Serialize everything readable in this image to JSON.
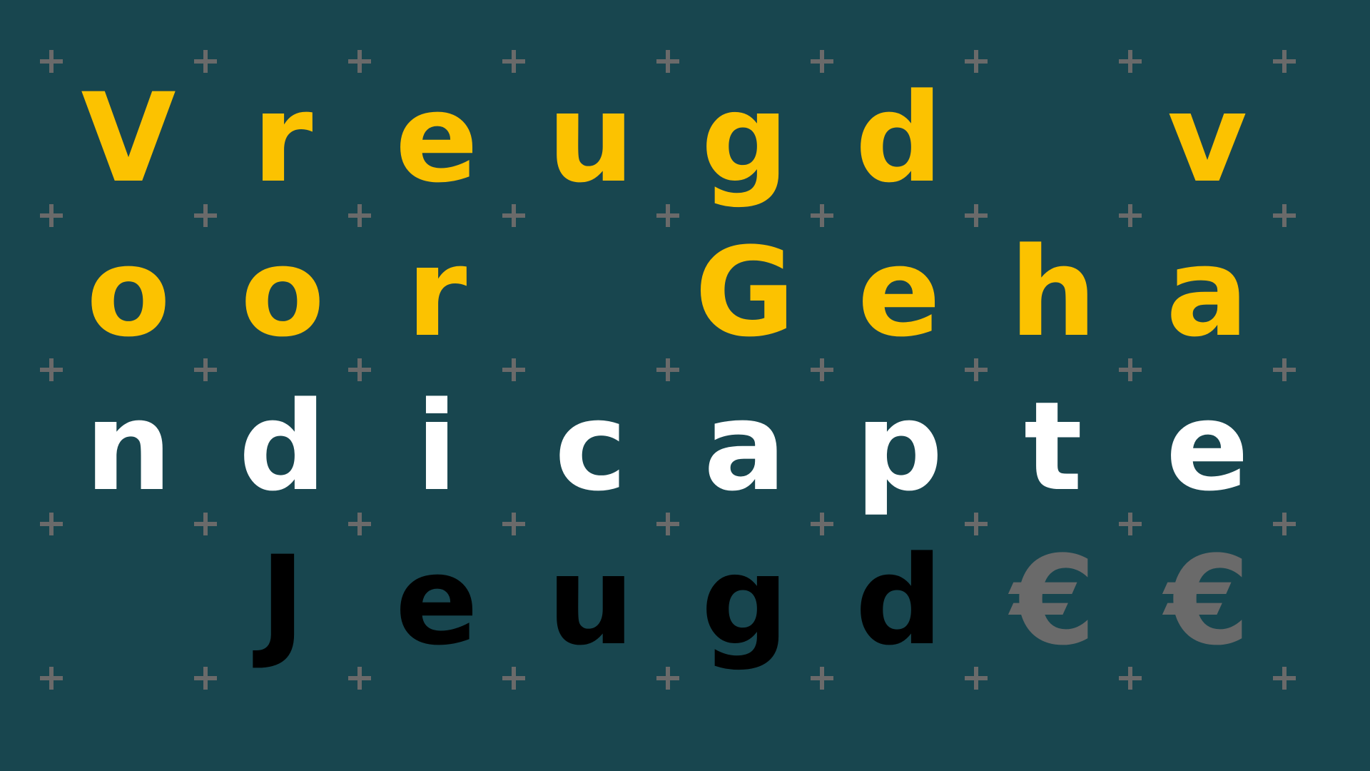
{
  "background_color": "#18464f",
  "plus_color": "#6a6a6a",
  "rows": [
    {
      "color": "#fcc200",
      "cells": [
        "V",
        "r",
        "e",
        "u",
        "g",
        "d",
        "",
        "v"
      ]
    },
    {
      "color": "#fcc200",
      "cells": [
        "o",
        "o",
        "r",
        "",
        "G",
        "e",
        "h",
        "a"
      ]
    },
    {
      "color": "#ffffff",
      "cells": [
        "n",
        "d",
        "i",
        "c",
        "a",
        "p",
        "t",
        "e"
      ]
    },
    {
      "color": "#000000",
      "cells": [
        "",
        "J",
        "e",
        "u",
        "g",
        "d",
        "€",
        "€"
      ]
    }
  ],
  "euro_color": "#6a6a6a"
}
